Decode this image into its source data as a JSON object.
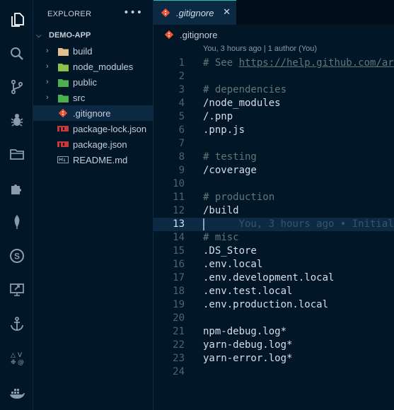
{
  "sidebar": {
    "title": "EXPLORER",
    "more": "•••",
    "section": "DEMO-APP",
    "items": [
      {
        "label": "build",
        "kind": "folder",
        "color": "#e2c08d"
      },
      {
        "label": "node_modules",
        "kind": "folder",
        "color": "#8bc34a"
      },
      {
        "label": "public",
        "kind": "folder",
        "color": "#4caf50"
      },
      {
        "label": "src",
        "kind": "folder",
        "color": "#4caf50"
      },
      {
        "label": ".gitignore",
        "kind": "file",
        "icon": "git-icon",
        "selected": true
      },
      {
        "label": "package-lock.json",
        "kind": "file",
        "icon": "npm-icon"
      },
      {
        "label": "package.json",
        "kind": "file",
        "icon": "npm-icon"
      },
      {
        "label": "README.md",
        "kind": "file",
        "icon": "markdown-icon"
      }
    ]
  },
  "tab": {
    "label": ".gitignore",
    "close": "✕"
  },
  "breadcrumb": {
    "label": ".gitignore"
  },
  "codelens": "You, 3 hours ago | 1 author (You)",
  "editor": {
    "lines": [
      {
        "n": "1",
        "text": "# See ",
        "link": "https://help.github.com/ar",
        "kind": "comment"
      },
      {
        "n": "2",
        "text": "",
        "kind": "blank"
      },
      {
        "n": "3",
        "text": "# dependencies",
        "kind": "comment"
      },
      {
        "n": "4",
        "text": "/node_modules",
        "kind": "path"
      },
      {
        "n": "5",
        "text": "/.pnp",
        "kind": "path"
      },
      {
        "n": "6",
        "text": ".pnp.js",
        "kind": "path"
      },
      {
        "n": "7",
        "text": "",
        "kind": "blank"
      },
      {
        "n": "8",
        "text": "# testing",
        "kind": "comment"
      },
      {
        "n": "9",
        "text": "/coverage",
        "kind": "path"
      },
      {
        "n": "10",
        "text": "",
        "kind": "blank"
      },
      {
        "n": "11",
        "text": "# production",
        "kind": "comment"
      },
      {
        "n": "12",
        "text": "/build",
        "kind": "path"
      },
      {
        "n": "13",
        "text": "",
        "kind": "current",
        "blame": "You, 3 hours ago • Initial"
      },
      {
        "n": "14",
        "text": "# misc",
        "kind": "comment"
      },
      {
        "n": "15",
        "text": ".DS_Store",
        "kind": "path"
      },
      {
        "n": "16",
        "text": ".env.local",
        "kind": "path"
      },
      {
        "n": "17",
        "text": ".env.development.local",
        "kind": "path"
      },
      {
        "n": "18",
        "text": ".env.test.local",
        "kind": "path"
      },
      {
        "n": "19",
        "text": ".env.production.local",
        "kind": "path"
      },
      {
        "n": "20",
        "text": "",
        "kind": "blank"
      },
      {
        "n": "21",
        "text": "npm-debug.log*",
        "kind": "path"
      },
      {
        "n": "22",
        "text": "yarn-debug.log*",
        "kind": "path"
      },
      {
        "n": "23",
        "text": "yarn-error.log*",
        "kind": "path"
      },
      {
        "n": "24",
        "text": "",
        "kind": "blank"
      }
    ]
  },
  "activity": [
    "files-icon",
    "search-icon",
    "source-control-icon",
    "debug-icon",
    "folder-icon",
    "extensions-icon",
    "mongodb-icon",
    "s-icon",
    "remote-explorer-icon",
    "anchor-icon",
    "symbols-icon",
    "docker-icon"
  ]
}
